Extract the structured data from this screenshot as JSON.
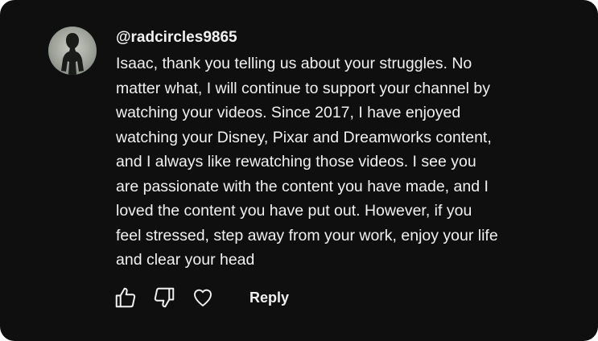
{
  "comment": {
    "author": "@radcircles9865",
    "text": "Isaac, thank you telling us about your struggles. No\nmatter what, I will continue to support your channel by\nwatching your videos. Since 2017, I have enjoyed\nwatching your Disney, Pixar and Dreamworks content,\nand I always like rewatching those videos. I see you\nare passionate with the content you have made, and I\nloved the content you have put out. However, if you\nfeel stressed, step away from your work, enjoy your life\nand clear your head"
  },
  "actions": {
    "like_icon": "thumbs-up-icon",
    "dislike_icon": "thumbs-down-icon",
    "heart_icon": "heart-icon",
    "reply_label": "Reply"
  },
  "colors": {
    "background": "#0f0f0f",
    "text": "#f1f1f1"
  }
}
